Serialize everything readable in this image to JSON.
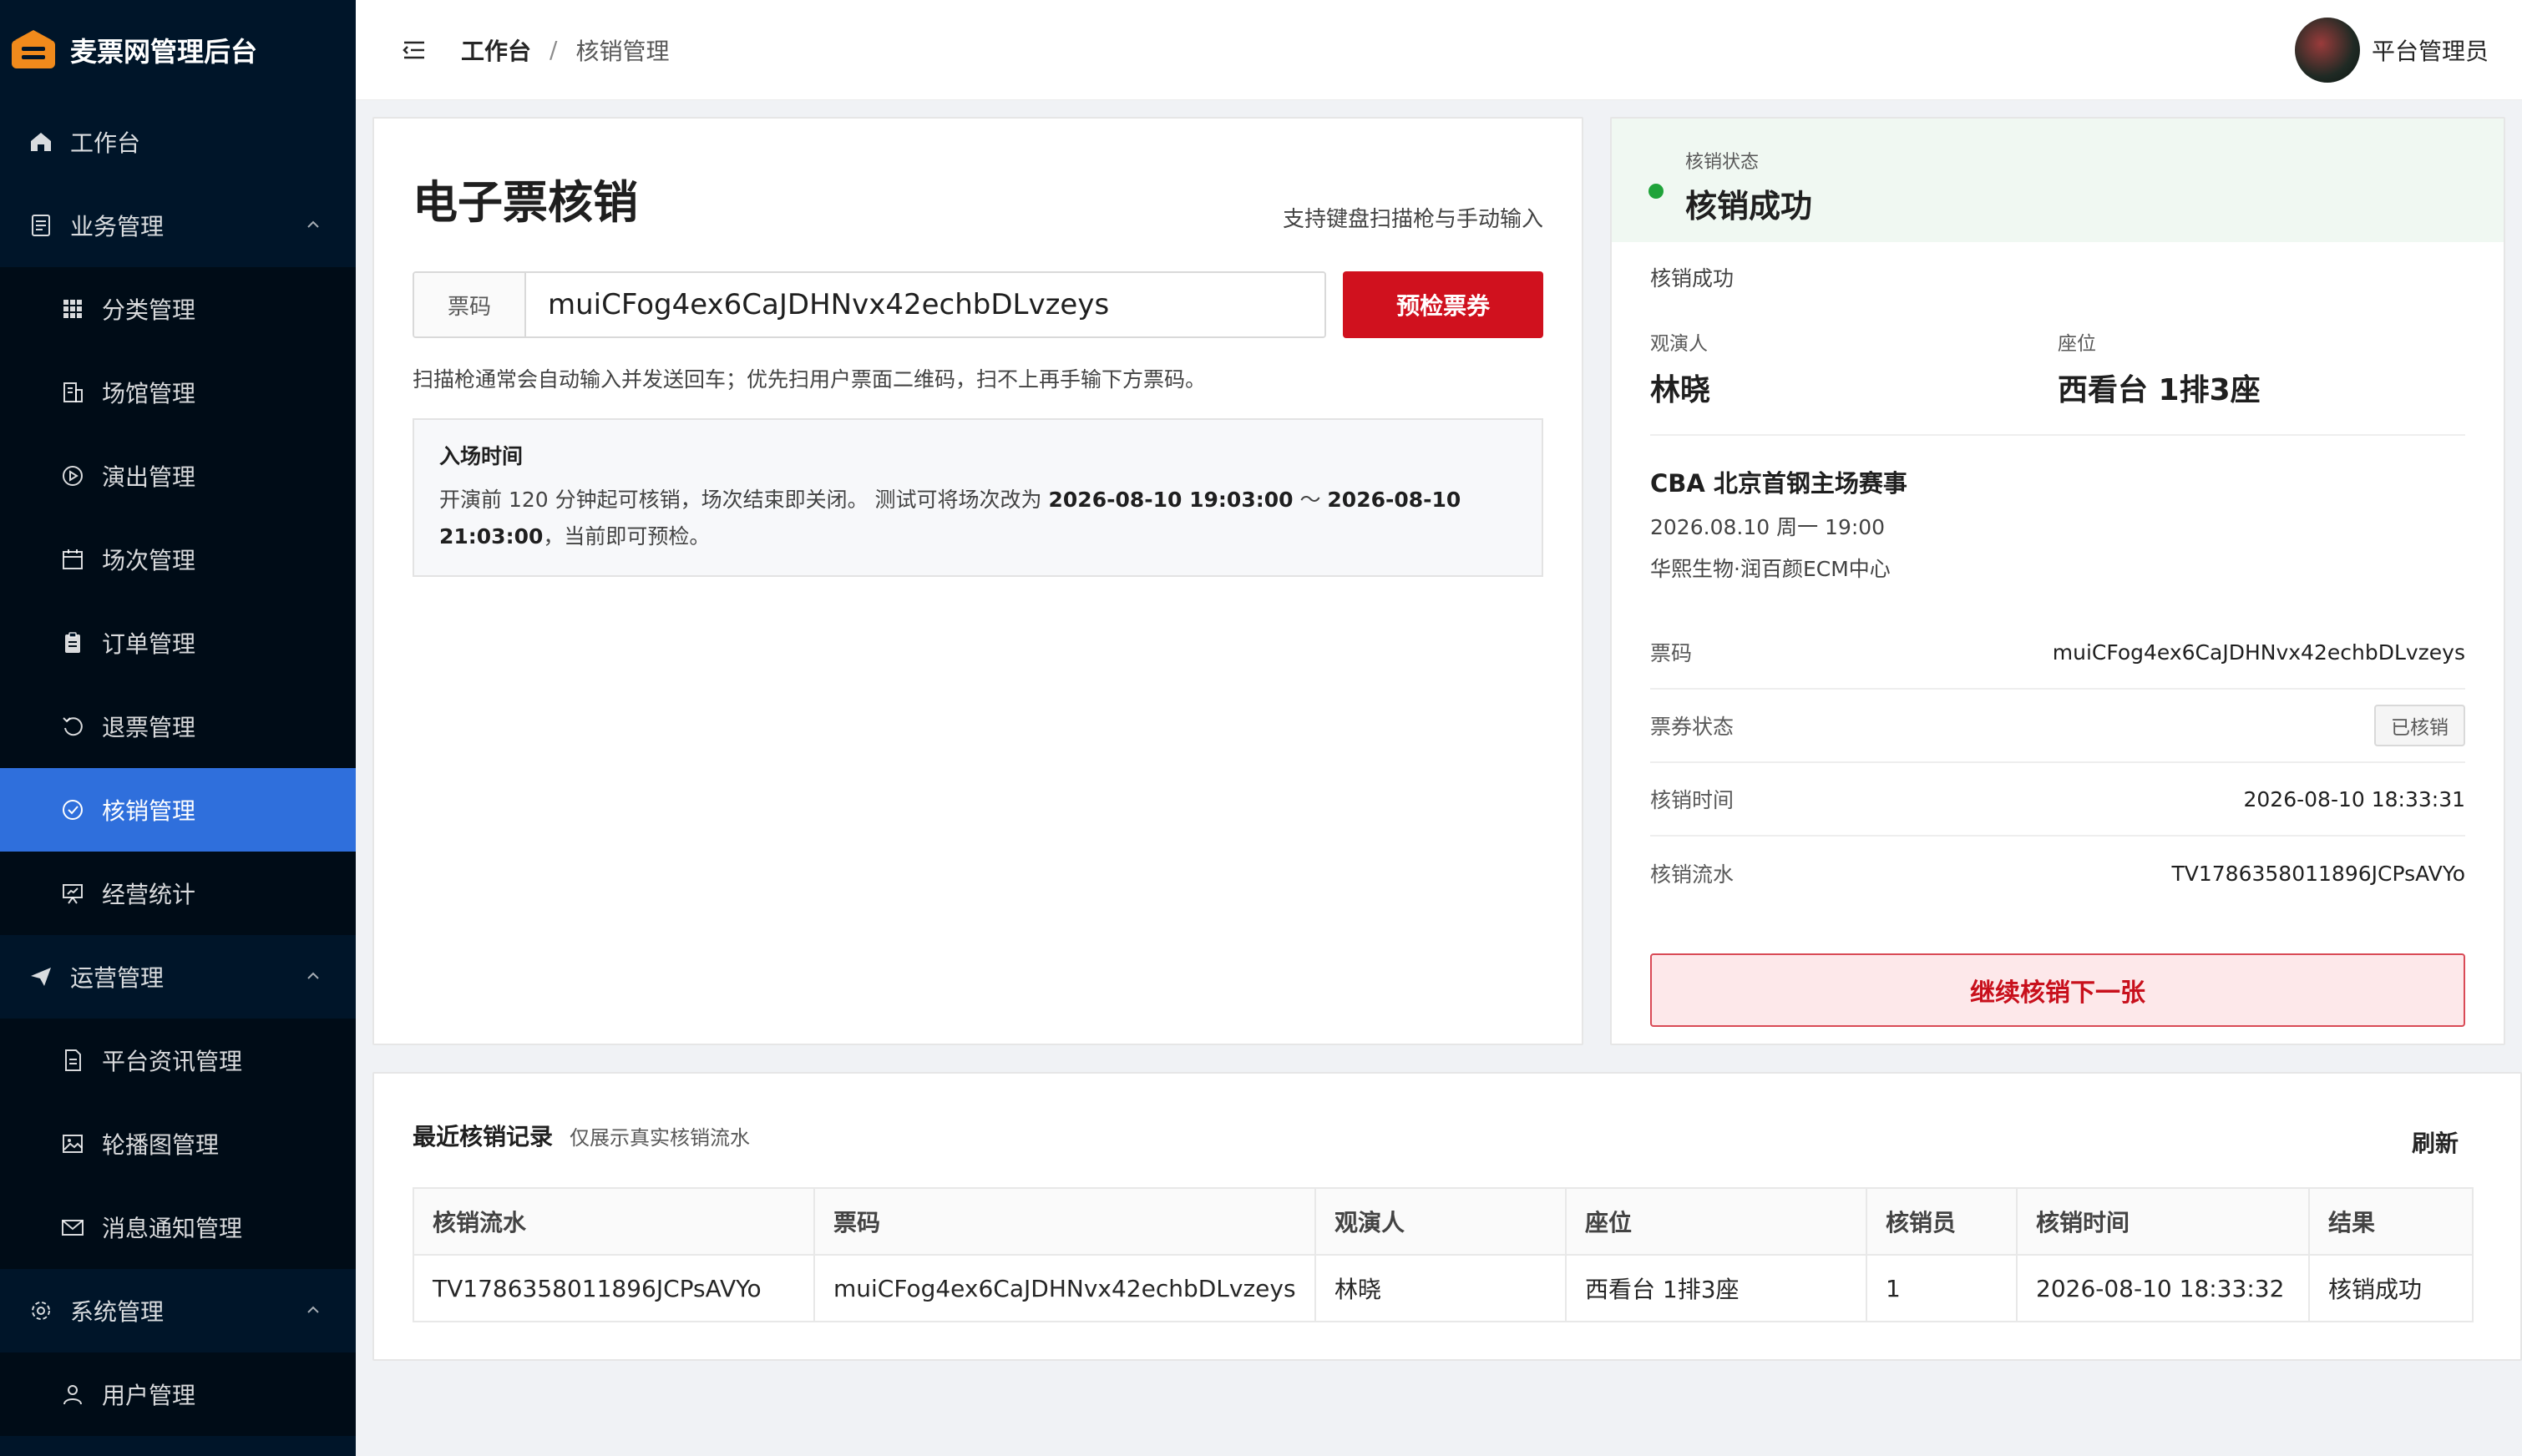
{
  "app": {
    "title": "麦票网管理后台"
  },
  "sidebar": {
    "items": [
      {
        "label": "工作台",
        "icon": "home-icon"
      },
      {
        "label": "业务管理",
        "icon": "document-icon"
      },
      {
        "label": "分类管理",
        "icon": "grid-icon"
      },
      {
        "label": "场馆管理",
        "icon": "building-icon"
      },
      {
        "label": "演出管理",
        "icon": "play-icon"
      },
      {
        "label": "场次管理",
        "icon": "calendar-icon"
      },
      {
        "label": "订单管理",
        "icon": "clipboard-icon"
      },
      {
        "label": "退票管理",
        "icon": "undo-icon"
      },
      {
        "label": "核销管理",
        "icon": "check-circle-icon"
      },
      {
        "label": "经营统计",
        "icon": "presentation-icon"
      },
      {
        "label": "运营管理",
        "icon": "send-icon"
      },
      {
        "label": "平台资讯管理",
        "icon": "file-text-icon"
      },
      {
        "label": "轮播图管理",
        "icon": "image-icon"
      },
      {
        "label": "消息通知管理",
        "icon": "mail-icon"
      },
      {
        "label": "系统管理",
        "icon": "gear-icon"
      },
      {
        "label": "用户管理",
        "icon": "user-icon"
      }
    ],
    "active": "核销管理"
  },
  "header": {
    "breadcrumb_home": "工作台",
    "breadcrumb_sep": "/",
    "breadcrumb_current": "核销管理",
    "user_name": "平台管理员"
  },
  "verify": {
    "title": "电子票核销",
    "hint": "支持键盘扫描枪与手动输入",
    "addon_label": "票码",
    "ticket_value": "muiCFog4ex6CaJDHNvx42echbDLvzeys",
    "precheck_label": "预检票券",
    "scan_tip": "扫描枪通常会自动输入并发送回车；优先扫用户票面二维码，扫不上再手输下方票码。",
    "entry_title": "入场时间",
    "entry_text_1": "开演前 120 分钟起可核销，场次结束即关闭。 测试可将场次改为 ",
    "entry_time_start": "2026-08-10 19:03:00",
    "entry_tilde": " ～ ",
    "entry_time_end": "2026-08-10 21:03:00",
    "entry_text_2": "，当前即可预检。"
  },
  "result": {
    "status_label": "核销状态",
    "status_value": "核销成功",
    "subtitle": "核销成功",
    "viewer_label": "观演人",
    "viewer_value": "林晓",
    "seat_label": "座位",
    "seat_value": "西看台 1排3座",
    "event_name": "CBA 北京首钢主场赛事",
    "event_time": "2026.08.10 周一 19:00",
    "event_venue": "华熙生物·润百颜ECM中心",
    "fields": {
      "code_label": "票码",
      "code_value": "muiCFog4ex6CaJDHNvx42echbDLvzeys",
      "ticket_status_label": "票券状态",
      "ticket_status_value": "已核销",
      "verify_time_label": "核销时间",
      "verify_time_value": "2026-08-10 18:33:31",
      "serial_label": "核销流水",
      "serial_value": "TV1786358011896JCPsAVYo"
    },
    "next_label": "继续核销下一张",
    "status_color": "#1fa33a"
  },
  "records": {
    "title": "最近核销记录",
    "subtitle": "仅展示真实核销流水",
    "refresh_label": "刷新",
    "columns": [
      "核销流水",
      "票码",
      "观演人",
      "座位",
      "核销员",
      "核销时间",
      "结果"
    ],
    "rows": [
      [
        "TV1786358011896JCPsAVYo",
        "muiCFog4ex6CaJDHNvx42echbDLvzeys",
        "林晓",
        "西看台 1排3座",
        "1",
        "2026-08-10 18:33:32",
        "核销成功"
      ]
    ]
  },
  "colors": {
    "primary": "#d0111e",
    "sidebar_bg": "#001529",
    "active_bg": "#2f6fdc"
  }
}
